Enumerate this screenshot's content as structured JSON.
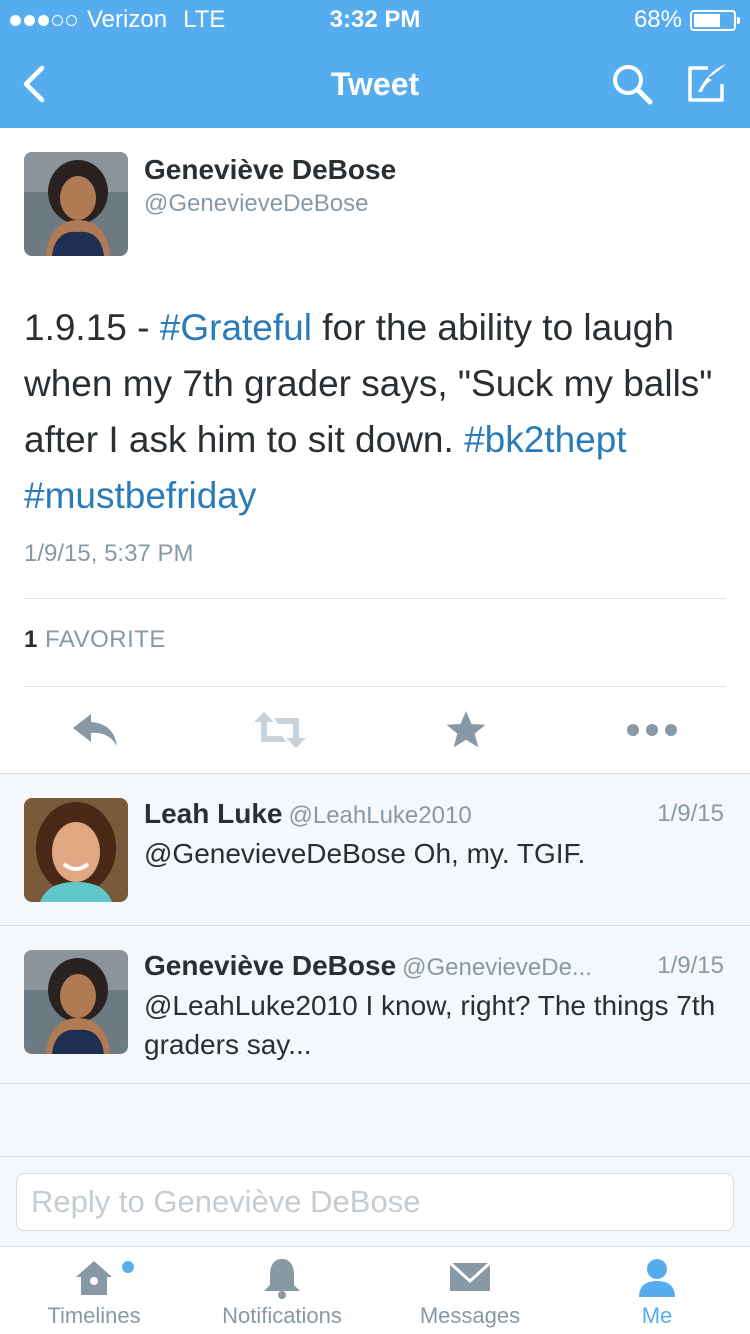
{
  "status_bar": {
    "carrier": "Verizon",
    "network": "LTE",
    "time": "3:32 PM",
    "battery": "68%",
    "battery_level": 0.68,
    "signal_bars": 3,
    "signal_total": 5
  },
  "nav": {
    "title": "Tweet"
  },
  "tweet": {
    "author_name": "Geneviève DeBose",
    "author_handle": "@GenevieveDeBose",
    "text_parts": {
      "p1": "1.9.15 - ",
      "tag1": "#Grateful",
      "p2": " for the ability to laugh when my 7th grader says, \"Suck my balls\" after I ask him to sit down. ",
      "tag2": "#bk2thept",
      "p3": " ",
      "tag3": "#mustbefriday"
    },
    "date": "1/9/15, 5:37 PM",
    "favorite_count": "1",
    "favorite_label": "FAVORITE"
  },
  "replies": [
    {
      "name": "Leah Luke",
      "handle": "@LeahLuke2010",
      "date": "1/9/15",
      "text": "@GenevieveDeBose Oh, my. TGIF."
    },
    {
      "name": "Geneviève DeBose",
      "handle": "@GenevieveDe...",
      "date": "1/9/15",
      "text": "@LeahLuke2010 I know, right? The things 7th graders say..."
    }
  ],
  "reply_box": {
    "placeholder": "Reply to Geneviève DeBose"
  },
  "tabs": [
    {
      "label": "Timelines",
      "icon": "home-icon"
    },
    {
      "label": "Notifications",
      "icon": "bell-icon"
    },
    {
      "label": "Messages",
      "icon": "envelope-icon"
    },
    {
      "label": "Me",
      "icon": "person-icon",
      "active": true
    }
  ],
  "colors": {
    "brand": "#55acee",
    "link": "#2b7bb9",
    "muted": "#8899a6",
    "text": "#292f33"
  }
}
